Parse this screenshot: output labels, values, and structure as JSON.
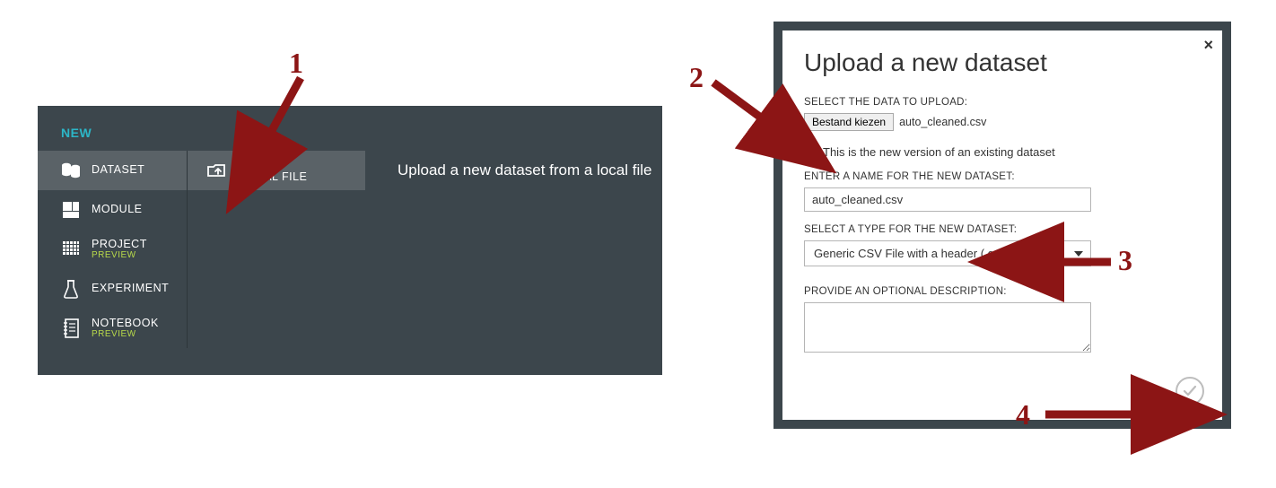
{
  "leftPanel": {
    "header": "NEW",
    "items": [
      {
        "label": "DATASET",
        "preview": ""
      },
      {
        "label": "MODULE",
        "preview": ""
      },
      {
        "label": "PROJECT",
        "preview": "PREVIEW"
      },
      {
        "label": "EXPERIMENT",
        "preview": ""
      },
      {
        "label": "NOTEBOOK",
        "preview": "PREVIEW"
      }
    ],
    "option": {
      "line1": "FROM",
      "line2": "LOCAL FILE"
    },
    "description": "Upload a new dataset from a local file"
  },
  "dialog": {
    "title": "Upload a new dataset",
    "selectDataLabel": "SELECT THE DATA TO UPLOAD:",
    "chooseFileBtn": "Bestand kiezen",
    "chosenFile": "auto_cleaned.csv",
    "newVersionLabel": "This is the new version of an existing dataset",
    "nameLabel": "ENTER A NAME FOR THE NEW DATASET:",
    "nameValue": "auto_cleaned.csv",
    "typeLabel": "SELECT A TYPE FOR THE NEW DATASET:",
    "typeValue": "Generic CSV File with a header (.csv)",
    "descLabel": "PROVIDE AN OPTIONAL DESCRIPTION:",
    "descValue": ""
  },
  "annotations": {
    "n1": "1",
    "n2": "2",
    "n3": "3",
    "n4": "4"
  }
}
